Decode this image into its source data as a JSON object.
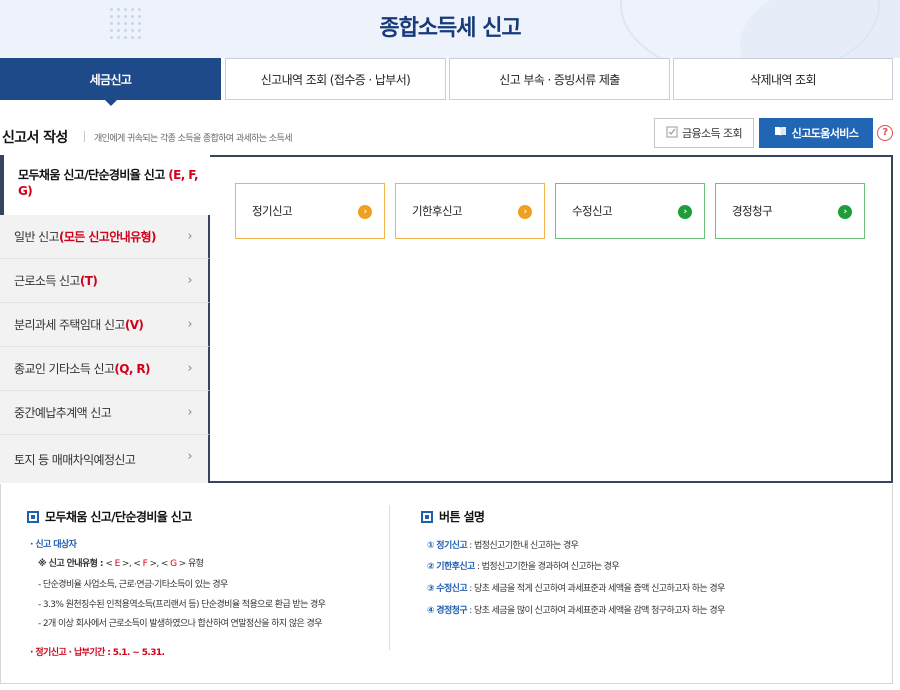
{
  "header": {
    "title": "종합소득세 신고"
  },
  "tabs": [
    {
      "label": "세금신고",
      "active": true
    },
    {
      "label": "신고내역 조회 (접수증 · 납부서)"
    },
    {
      "label": "신고 부속 · 증빙서류 제출"
    },
    {
      "label": "삭제내역 조회"
    }
  ],
  "section": {
    "title": "신고서 작성",
    "description": "개인에게 귀속되는 각종 소득을 종합하여 과세하는 소득세"
  },
  "actions": {
    "financial_label": "금융소득 조회",
    "help_label": "신고도움서비스",
    "question_mark": "?"
  },
  "sidebar": {
    "active": {
      "label": "모두채움 신고/단순경비율 신고 ",
      "code": "(E, F, G)"
    },
    "items": [
      {
        "label": "일반 신고 ",
        "code": "(모든 신고안내유형)"
      },
      {
        "label": "근로소득 신고 ",
        "code": "(T)"
      },
      {
        "label": "분리과세 주택임대 신고 ",
        "code": "(V)"
      },
      {
        "label": "종교인 기타소득 신고 ",
        "code": "(Q, R)"
      },
      {
        "label": "중간예납추계액 신고",
        "code": ""
      },
      {
        "label": "토지 등 매매차익예정신고",
        "code": ""
      }
    ],
    "chevron": "›"
  },
  "options": [
    {
      "label": "정기신고",
      "color": "#f0a020"
    },
    {
      "label": "기한후신고",
      "color": "#f0a020"
    },
    {
      "label": "수정신고",
      "color": "#1f9d3a"
    },
    {
      "label": "경정청구",
      "color": "#1f9d3a"
    }
  ],
  "info_left": {
    "title": "모두채움 신고/단순경비율 신고",
    "target_label": "· 신고 대상자",
    "type_prefix": "※ 신고 안내유형 : ",
    "type_lt1": "< ",
    "type_e": "E",
    "type_gt1": " >, ",
    "type_lt2": "< ",
    "type_f": "F",
    "type_gt2": " >, ",
    "type_lt3": "< ",
    "type_g": "G",
    "type_gt3": " > 유형",
    "lines": [
      "- 단순경비율 사업소득, 근로·연금·기타소득이 있는 경우",
      "- 3.3% 원천징수된 인적용역소득(프리랜서 등) 단순경비율 적용으로 환급 받는 경우",
      "- 2개 이상 회사에서 근로소득이 발생하였으나 합산하여 연말정산을 하지 않은 경우"
    ],
    "period": "· 정기신고 · 납부기간 : 5.1. ~ 5.31."
  },
  "info_right": {
    "title": "버튼 설명",
    "items": [
      {
        "num": "①",
        "term": "정기신고",
        "desc": " : 법정신고기한내 신고하는 경우"
      },
      {
        "num": "②",
        "term": "기한후신고",
        "desc": " : 법정신고기한을 경과하여 신고하는 경우"
      },
      {
        "num": "③",
        "term": "수정신고",
        "desc": " : 당초 세금을 적게 신고하여 과세표준과 세액을 증액 신고하고자 하는 경우"
      },
      {
        "num": "④",
        "term": "경정청구",
        "desc": " : 당초 세금을 많이 신고하여 과세표준과 세액을 감액 청구하고자 하는 경우"
      }
    ]
  },
  "colors": {
    "primary": "#1f4a8a",
    "accent_blue": "#2166b4",
    "accent_red": "#d0021b",
    "orange": "#f0a020",
    "green": "#1f9d3a"
  }
}
